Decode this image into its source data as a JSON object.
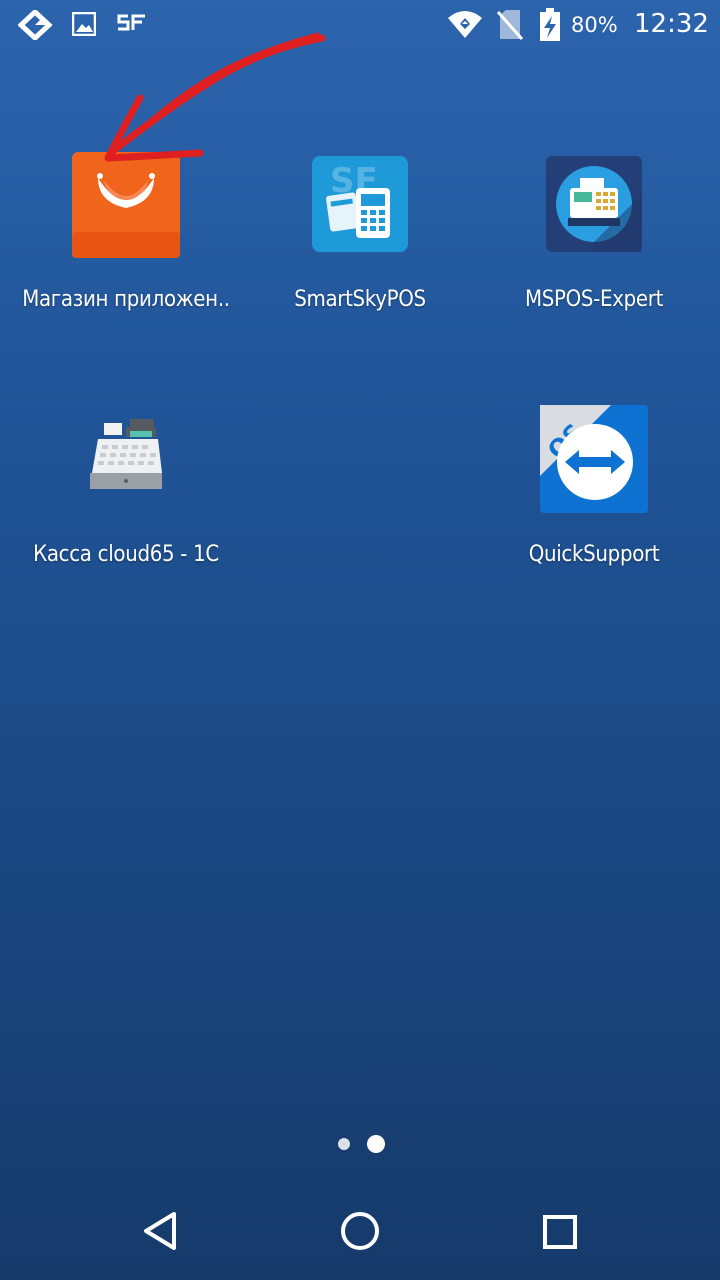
{
  "status_bar": {
    "icons": [
      "launcher-diamond-icon",
      "image-notification-icon",
      "sf-notification-icon",
      "wifi-icon",
      "no-sim-icon",
      "battery-charging-icon"
    ],
    "battery_percent": "80%",
    "time": "12:32"
  },
  "apps": [
    {
      "label": "Магазин приложен..",
      "icon": "shopping-bag-icon",
      "color": "#f0641c"
    },
    {
      "label": "SmartSkyPOS",
      "icon": "smartskypos-icon",
      "color": "#1e9ad8"
    },
    {
      "label": "MSPOS-Expert",
      "icon": "cash-register-circle-icon",
      "color": "#2a9ee0"
    },
    {
      "label": "Касса cloud65 - 1С",
      "icon": "cash-register-icon",
      "color": "#e8ecef"
    },
    {
      "label": "QuickSupport",
      "icon": "quicksupport-icon",
      "color": "#0e72d2"
    }
  ],
  "page_indicator": {
    "pages": 2,
    "current": 2
  },
  "nav_bar": {
    "back": "back-icon",
    "home": "home-icon",
    "recents": "recents-icon"
  },
  "annotation": {
    "color": "#e02020",
    "icon": "red-arrow-annotation"
  }
}
